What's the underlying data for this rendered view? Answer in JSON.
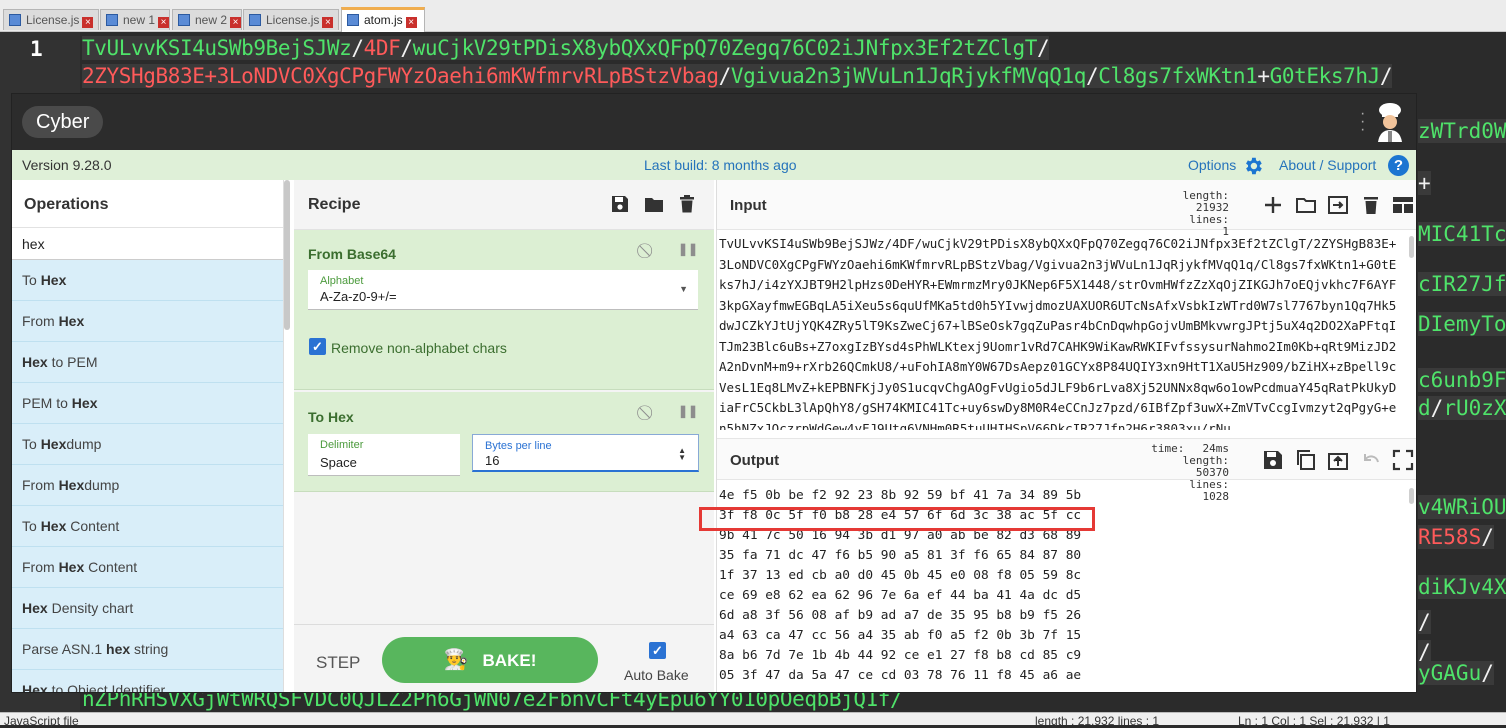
{
  "file_tabs": [
    {
      "label": "License.js",
      "active": false
    },
    {
      "label": "new 1",
      "active": false
    },
    {
      "label": "new 2",
      "active": false
    },
    {
      "label": "License.js",
      "active": false
    },
    {
      "label": "atom.js",
      "active": true
    }
  ],
  "editor": {
    "line_number": "1",
    "line1": [
      {
        "t": "TvULvvKSI4uSWb9BejSJWz",
        "c": "g"
      },
      {
        "t": "/",
        "c": "w"
      },
      {
        "t": "4DF",
        "c": "r"
      },
      {
        "t": "/",
        "c": "w"
      },
      {
        "t": "wuCjkV29tPDisX8ybQXxQFpQ70Zegq76C02iJNfpx3Ef2tZClgT",
        "c": "g"
      },
      {
        "t": "/",
        "c": "w"
      }
    ],
    "line2": [
      {
        "t": "2ZYSHgB83E+3LoNDVC0XgCPgFWYzOaehi6mKWfmrvRLpBStzVbag",
        "c": "r"
      },
      {
        "t": "/",
        "c": "w"
      },
      {
        "t": "Vgivua2n3jWVuLn1JqRjykfMVqQ1q",
        "c": "g"
      },
      {
        "t": "/",
        "c": "w"
      },
      {
        "t": "Cl8gs7fxWKtn1",
        "c": "g"
      },
      {
        "t": "+",
        "c": "w"
      },
      {
        "t": "G0tEks7hJ",
        "c": "g"
      },
      {
        "t": "/",
        "c": "w"
      }
    ],
    "side": [
      {
        "segs": [
          {
            "t": "zWTrd0W",
            "c": "g"
          }
        ]
      },
      {
        "segs": [
          {
            "t": "+",
            "c": "w"
          }
        ]
      },
      {
        "segs": [
          {
            "t": "MIC41Tc+",
            "c": "g"
          }
        ]
      },
      {
        "segs": [
          {
            "t": "cIR27Jf",
            "c": "g"
          }
        ]
      },
      {
        "segs": [
          {
            "t": "DIemyTo",
            "c": "g"
          }
        ]
      },
      {
        "segs": [
          {
            "t": "c6unb9F",
            "c": "g"
          }
        ]
      },
      {
        "segs": [
          {
            "t": "d",
            "c": "g"
          },
          {
            "t": "/",
            "c": "w"
          },
          {
            "t": "rU0zX",
            "c": "g"
          }
        ]
      },
      {
        "segs": [
          {
            "t": "v4WRiOU",
            "c": "g"
          }
        ]
      },
      {
        "segs": [
          {
            "t": "RE58S",
            "c": "r"
          },
          {
            "t": "/",
            "c": "w"
          }
        ]
      },
      {
        "segs": [
          {
            "t": "diKJv4X",
            "c": "g"
          }
        ]
      },
      {
        "segs": [
          {
            "t": "/",
            "c": "w"
          }
        ]
      },
      {
        "segs": [
          {
            "t": "/",
            "c": "w"
          }
        ]
      },
      {
        "segs": [
          {
            "t": "yGAGu",
            "c": "g"
          },
          {
            "t": "/",
            "c": "w"
          }
        ]
      }
    ],
    "bottom_line": "nZPhRHSVXGjWtWRQSFVDC0QJLZ2Ph6GjWN07e2FbnvCFt4yEpu6YY010pOeqbBjQ1f/"
  },
  "statusbar": {
    "filetype": "JavaScript file",
    "length": "length : 21,932    lines : 1",
    "ln": "Ln : 1    Col : 1    Sel : 21,932 | 1"
  },
  "cyberchef": {
    "logo": "Cyber",
    "version": "Version 9.28.0",
    "last_build": "Last build: 8 months ago",
    "options": "Options",
    "about": "About / Support",
    "operations": {
      "title": "Operations",
      "search_value": "hex",
      "items": [
        {
          "pre": "To ",
          "bold": "Hex",
          "post": ""
        },
        {
          "pre": "From ",
          "bold": "Hex",
          "post": ""
        },
        {
          "pre": "",
          "bold": "Hex",
          "post": " to PEM"
        },
        {
          "pre": "PEM to ",
          "bold": "Hex",
          "post": ""
        },
        {
          "pre": "To ",
          "bold": "Hex",
          "post": "dump"
        },
        {
          "pre": "From ",
          "bold": "Hex",
          "post": "dump"
        },
        {
          "pre": "To ",
          "bold": "Hex",
          "post": " Content"
        },
        {
          "pre": "From ",
          "bold": "Hex",
          "post": " Content"
        },
        {
          "pre": "",
          "bold": "Hex",
          "post": " Density chart"
        },
        {
          "pre": "Parse ASN.1 ",
          "bold": "hex",
          "post": " string"
        },
        {
          "pre": "",
          "bold": "Hex",
          "post": " to Object Identifier"
        }
      ]
    },
    "recipe": {
      "title": "Recipe",
      "from_base64": {
        "title": "From Base64",
        "alphabet_label": "Alphabet",
        "alphabet_value": "A-Za-z0-9+/=",
        "remove_label": "Remove non-alphabet chars"
      },
      "to_hex": {
        "title": "To Hex",
        "delimiter_label": "Delimiter",
        "delimiter_value": "Space",
        "bytes_label": "Bytes per line",
        "bytes_value": "16"
      },
      "step": "STEP",
      "bake": "BAKE!",
      "auto_bake": "Auto Bake"
    },
    "input": {
      "title": "Input",
      "length_label": "length:",
      "length_value": "21932",
      "lines_label": "lines:",
      "lines_value": "1",
      "text": "TvULvvKSI4uSWb9BejSJWz/4DF/wuCjkV29tPDisX8ybQXxQFpQ70Zegq76C02iJNfpx3Ef2tZClgT/2ZYSHgB83E+3LoNDVC0XgCPgFWYzOaehi6mKWfmrvRLpBStzVbag/Vgivua2n3jWVuLn1JqRjykfMVqQ1q/Cl8gs7fxWKtn1+G0tEks7hJ/i4zYXJBT9H2lpHzs0DeHYR+EWmrmzMry0JKNep6F5X1448/strOvmHWfzZzXqOjZIKGJh7oEQjvkhc7F6AYF3kpGXayfmwEGBqLA5iXeu5s6quUfMKa5td0h5YIvwjdmozUAXUOR6UTcNsAfxVsbkIzWTrd0W7sl7767byn1Qq7Hk5dwJCZkYJtUjYQK4ZRy5lT9KsZweCj67+lBSeOsk7gqZuPasr4bCnDqwhpGojvUmBMkvwrgJPtj5uX4q2DO2XaPFtqITJm23Blc6uBs+Z7oxgIzBYsd4sPhWLKtexj9Uomr1vRd7CAHK9WiKawRWKIFvfssysurNahmo2Im0Kb+qRt9MizJD2A2nDvnM+m9+rXrb26QCmkU8/+uFohIA8mY0W67DsAepz01GCYx8P84UQIY3xn9HtT1XaU5Hz909/bZiHX+zBpell9cVesL1Eq8LMvZ+kEPBNFKjJy0S1ucqvChgAOgFvUgio5dJLF9b6rLva8Xj52UNNx8qw6o1owPcdmuaY45qRatPkUkyDiaFrC5CkbL3lApQhY8/gSH74KMIC41Tc+uy6swDy8M0R4eCCnJz7pzd/6IBfZpf3uwX+ZmVTvCcgIvmzyt2qPgyG+en5hNZxJOczrpWdGew4yFJ9Utg6VNHm0R5tuUHIHSpV66DkcIR27Jfn2H6r3803xu/rNu"
    },
    "output": {
      "title": "Output",
      "time_label": "time:",
      "time_value": "24ms",
      "length_label": "length:",
      "length_value": "50370",
      "lines_label": "lines:",
      "lines_value": "1028",
      "rows": [
        "4e f5 0b be f2 92 23 8b 92 59 bf 41 7a 34 89 5b",
        "3f f8 0c 5f f0 b8 28 e4 57 6f 6d 3c 38 ac 5f cc",
        "9b 41 7c 50 16 94 3b d1 97 a0 ab be 82 d3 68 89",
        "35 fa 71 dc 47 f6 b5 90 a5 81 3f f6 65 84 87 80",
        "1f 37 13 ed cb a0 d0 45 0b 45 e0 08 f8 05 59 8c",
        "ce 69 e8 62 ea 62 96 7e 6a ef 44 ba 41 4a dc d5",
        "6d a8 3f 56 08 af b9 ad a7 de 35 95 b8 b9 f5 26",
        "a4 63 ca 47 cc 56 a4 35 ab f0 a5 f2 0b 3b 7f 15",
        "8a b6 7d 7e 1b 4b 44 92 ce e1 27 f8 b8 cd 85 c9",
        "05 3f 47 da 5a 47 ce cd 03 78 76 11 f8 45 a6 ae"
      ]
    }
  },
  "colors": {
    "green_text": "#4fe36a",
    "red_text": "#ff5a5a",
    "accent_blue": "#2573bb",
    "bake_green": "#58b65d",
    "highlight_red": "#e53935"
  }
}
